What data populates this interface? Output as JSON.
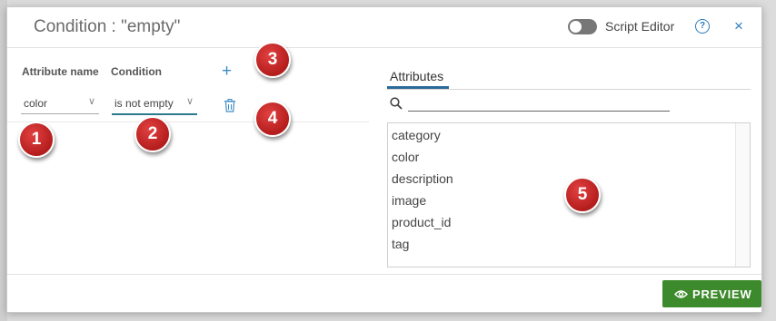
{
  "dialog": {
    "title": "Condition : \"empty\"",
    "script_editor_label": "Script Editor",
    "help_label": "?",
    "close_label": "×",
    "script_editor_on": false
  },
  "condition_builder": {
    "attribute_header": "Attribute name",
    "condition_header": "Condition",
    "add_label": "+",
    "row": {
      "attribute": "color",
      "condition": "is not empty"
    }
  },
  "attributes_panel": {
    "tab_label": "Attributes",
    "search_value": "",
    "items": [
      "category",
      "color",
      "description",
      "image",
      "product_id",
      "tag"
    ]
  },
  "footer": {
    "preview_label": "PREVIEW"
  },
  "markers": [
    "1",
    "2",
    "3",
    "4",
    "5"
  ],
  "colors": {
    "accent": "#2a7bbf",
    "preview": "#3d8a2c",
    "marker": "#c62828"
  }
}
